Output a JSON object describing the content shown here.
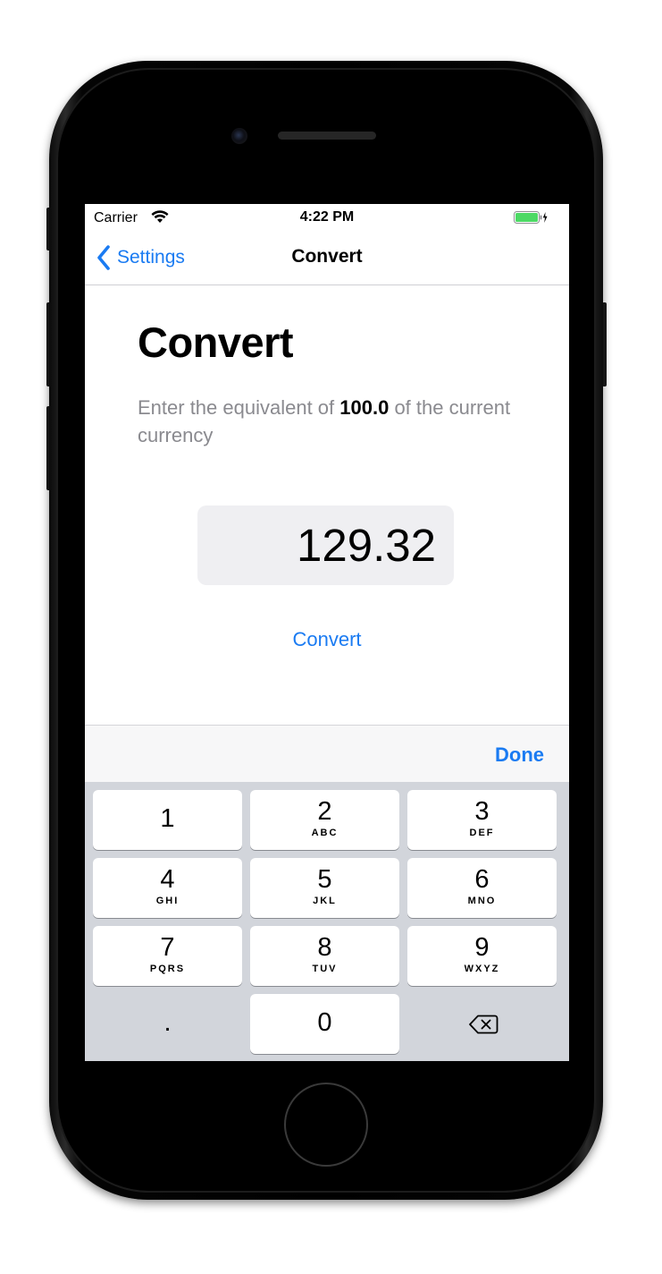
{
  "status_bar": {
    "carrier": "Carrier",
    "time": "4:22 PM",
    "wifi_icon": "wifi-icon",
    "battery_icon": "battery-charging-icon",
    "battery_color": "#4cd964"
  },
  "nav_bar": {
    "back_label": "Settings",
    "back_icon": "chevron-left-icon",
    "title": "Convert"
  },
  "main": {
    "heading": "Convert",
    "description_prefix": "Enter the equivalent of ",
    "description_amount": "100.0",
    "description_suffix": " of the current currency",
    "amount_value": "129.32",
    "convert_label": "Convert"
  },
  "accessory": {
    "done_label": "Done"
  },
  "keypad": {
    "keys": [
      {
        "num": "1",
        "letters": ""
      },
      {
        "num": "2",
        "letters": "ABC"
      },
      {
        "num": "3",
        "letters": "DEF"
      },
      {
        "num": "4",
        "letters": "GHI"
      },
      {
        "num": "5",
        "letters": "JKL"
      },
      {
        "num": "6",
        "letters": "MNO"
      },
      {
        "num": "7",
        "letters": "PQRS"
      },
      {
        "num": "8",
        "letters": "TUV"
      },
      {
        "num": "9",
        "letters": "WXYZ"
      },
      {
        "num": ".",
        "letters": ""
      },
      {
        "num": "0",
        "letters": ""
      }
    ],
    "backspace_icon": "backspace-icon"
  },
  "colors": {
    "accent": "#1a7bf2",
    "keypad_background": "#d2d5db",
    "field_background": "#efeff2"
  }
}
